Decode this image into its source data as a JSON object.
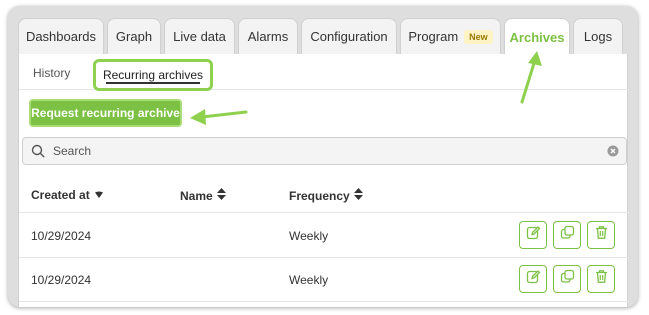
{
  "tabs": [
    {
      "label": "Dashboards"
    },
    {
      "label": "Graph"
    },
    {
      "label": "Live data"
    },
    {
      "label": "Alarms"
    },
    {
      "label": "Configuration"
    },
    {
      "label": "Program",
      "badge": "New"
    },
    {
      "label": "Archives",
      "active": true
    },
    {
      "label": "Logs"
    }
  ],
  "subtabs": {
    "history": "History",
    "recurring": "Recurring archives"
  },
  "request_button": "Request recurring archive",
  "search": {
    "placeholder": "Search",
    "value": ""
  },
  "table": {
    "columns": [
      "Created at",
      "Name",
      "Frequency"
    ],
    "rows": [
      {
        "created_at": "10/29/2024",
        "name": "",
        "frequency": "Weekly"
      },
      {
        "created_at": "10/29/2024",
        "name": "",
        "frequency": "Weekly"
      }
    ]
  },
  "colors": {
    "accent": "#7cc143",
    "highlight": "#8fd14f"
  },
  "icons": [
    "search-icon",
    "clear-icon",
    "sort-down-icon",
    "sort-icon",
    "edit-icon",
    "duplicate-icon",
    "delete-icon",
    "arrow-icon"
  ]
}
